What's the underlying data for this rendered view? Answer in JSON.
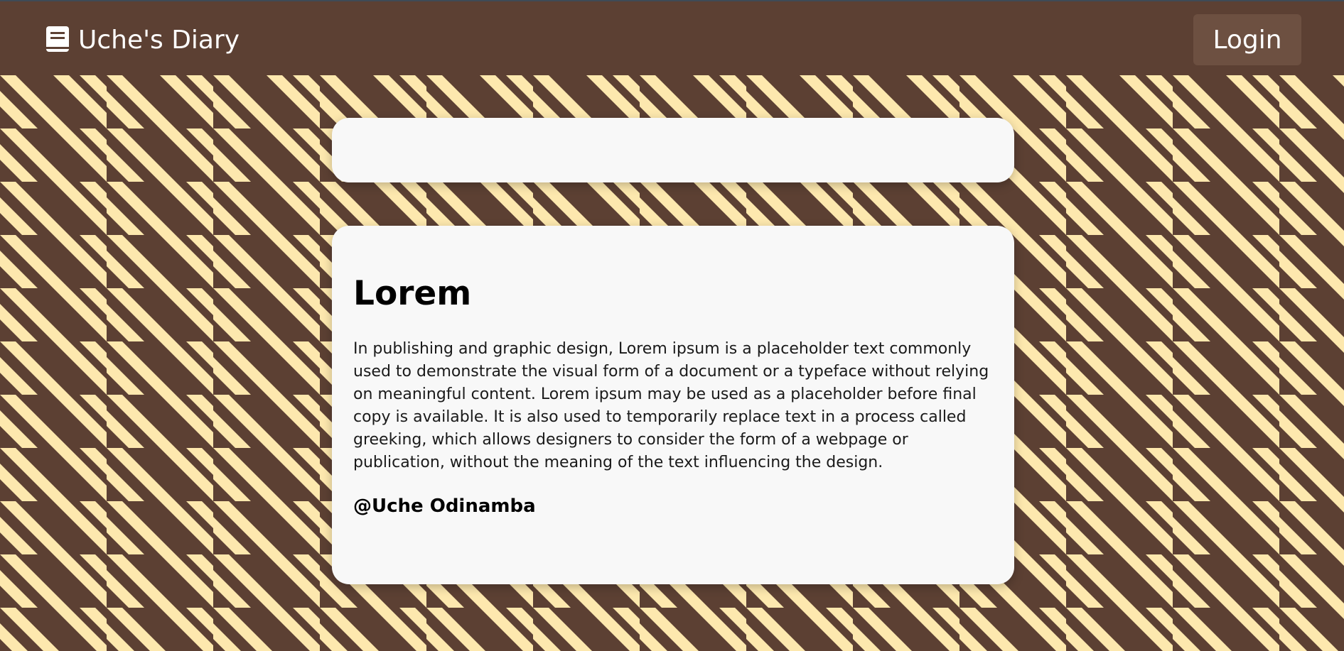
{
  "navbar": {
    "brand_text": "Uche's Diary",
    "brand_icon": "book-icon",
    "login_label": "Login"
  },
  "colors": {
    "brown": "#5c4033",
    "cream": "#fde8ae",
    "card": "#f8f8f8",
    "button": "#6d5041"
  },
  "post": {
    "title": "Lorem",
    "body": "In publishing and graphic design, Lorem ipsum is a placeholder text commonly used to demonstrate the visual form of a document or a typeface without relying on meaningful content. Lorem ipsum may be used as a placeholder before final copy is available. It is also used to temporarily replace text in a process called greeking, which allows designers to consider the form of a webpage or publication, without the meaning of the text influencing the design.",
    "author": "@Uche Odinamba"
  }
}
